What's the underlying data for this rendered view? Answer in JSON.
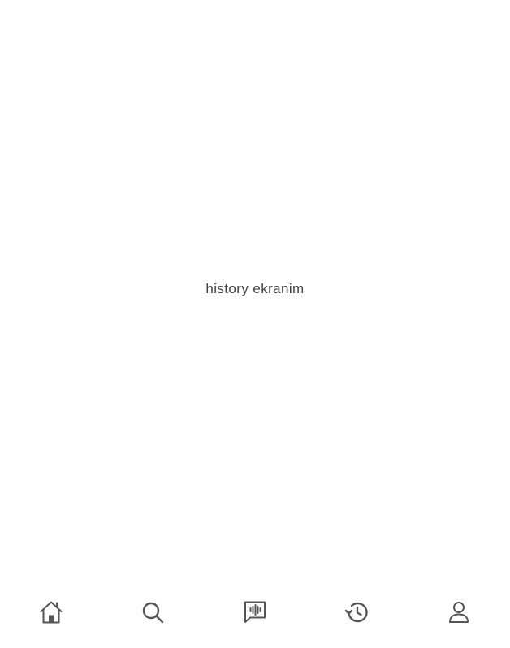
{
  "screen": {
    "label": "history ekranim"
  },
  "bottom_nav": {
    "items": [
      {
        "icon": "home-icon"
      },
      {
        "icon": "search-icon"
      },
      {
        "icon": "voice-message-icon"
      },
      {
        "icon": "history-icon"
      },
      {
        "icon": "profile-icon"
      }
    ],
    "icon_color": "#555555"
  }
}
